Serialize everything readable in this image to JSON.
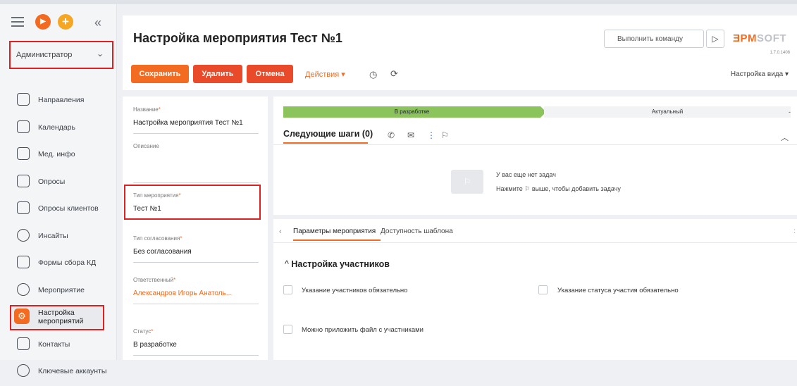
{
  "sidebar": {
    "role": "Администратор",
    "items": [
      {
        "label": "Направления",
        "icon": "document-icon"
      },
      {
        "label": "Календарь",
        "icon": "flag-icon"
      },
      {
        "label": "Мед. инфо",
        "icon": "chat-icon"
      },
      {
        "label": "Опросы",
        "icon": "list-icon"
      },
      {
        "label": "Опросы клиентов",
        "icon": "survey-icon"
      },
      {
        "label": "Инсайты",
        "icon": "target-icon"
      },
      {
        "label": "Формы сбора КД",
        "icon": "forms-icon"
      },
      {
        "label": "Мероприятие",
        "icon": "clock-icon"
      },
      {
        "label": "Настройка мероприятий",
        "icon": "settings-icon"
      },
      {
        "label": "Контакты",
        "icon": "contact-icon"
      },
      {
        "label": "Ключевые аккаунты",
        "icon": "accounts-icon"
      }
    ]
  },
  "header": {
    "title": "Настройка мероприятия Тест №1",
    "command_placeholder": "Выполнить команду",
    "logo_left": "ƎPM",
    "logo_right": "SOFT",
    "version": "1.7.0.1408",
    "save": "Сохранить",
    "delete": "Удалить",
    "cancel": "Отмена",
    "actions": "Действия ▾",
    "view": "Настройка вида ▾"
  },
  "form": {
    "name_label": "Название",
    "name_value": "Настройка мероприятия Тест №1",
    "desc_label": "Описание",
    "desc_value": "",
    "type_label": "Тип мероприятия",
    "type_value": "Тест №1",
    "approval_label": "Тип согласования",
    "approval_value": "Без согласования",
    "owner_label": "Ответственный",
    "owner_value": "Александров Игорь Анатоль...",
    "status_label": "Статус",
    "status_value": "В разработке"
  },
  "stages": {
    "current": "В разработке",
    "next": "Актуальный"
  },
  "next_steps": {
    "title": "Следующие шаги (0)",
    "empty_title": "У вас еще нет задач",
    "empty_hint": "Нажмите ⚐ выше, чтобы добавить задачу"
  },
  "tabs": {
    "tab1": "Параметры мероприятия",
    "tab2": "Доступность шаблона"
  },
  "participants": {
    "title": "Настройка участников",
    "cb1": "Указание участников обязательно",
    "cb2": "Указание статуса участия обязательно",
    "cb3": "Можно приложить файл с участниками"
  },
  "colors": {
    "accent": "#f26b21",
    "danger": "#e84a2a",
    "stage_done": "#8ac45a",
    "highlight": "#e02020"
  }
}
